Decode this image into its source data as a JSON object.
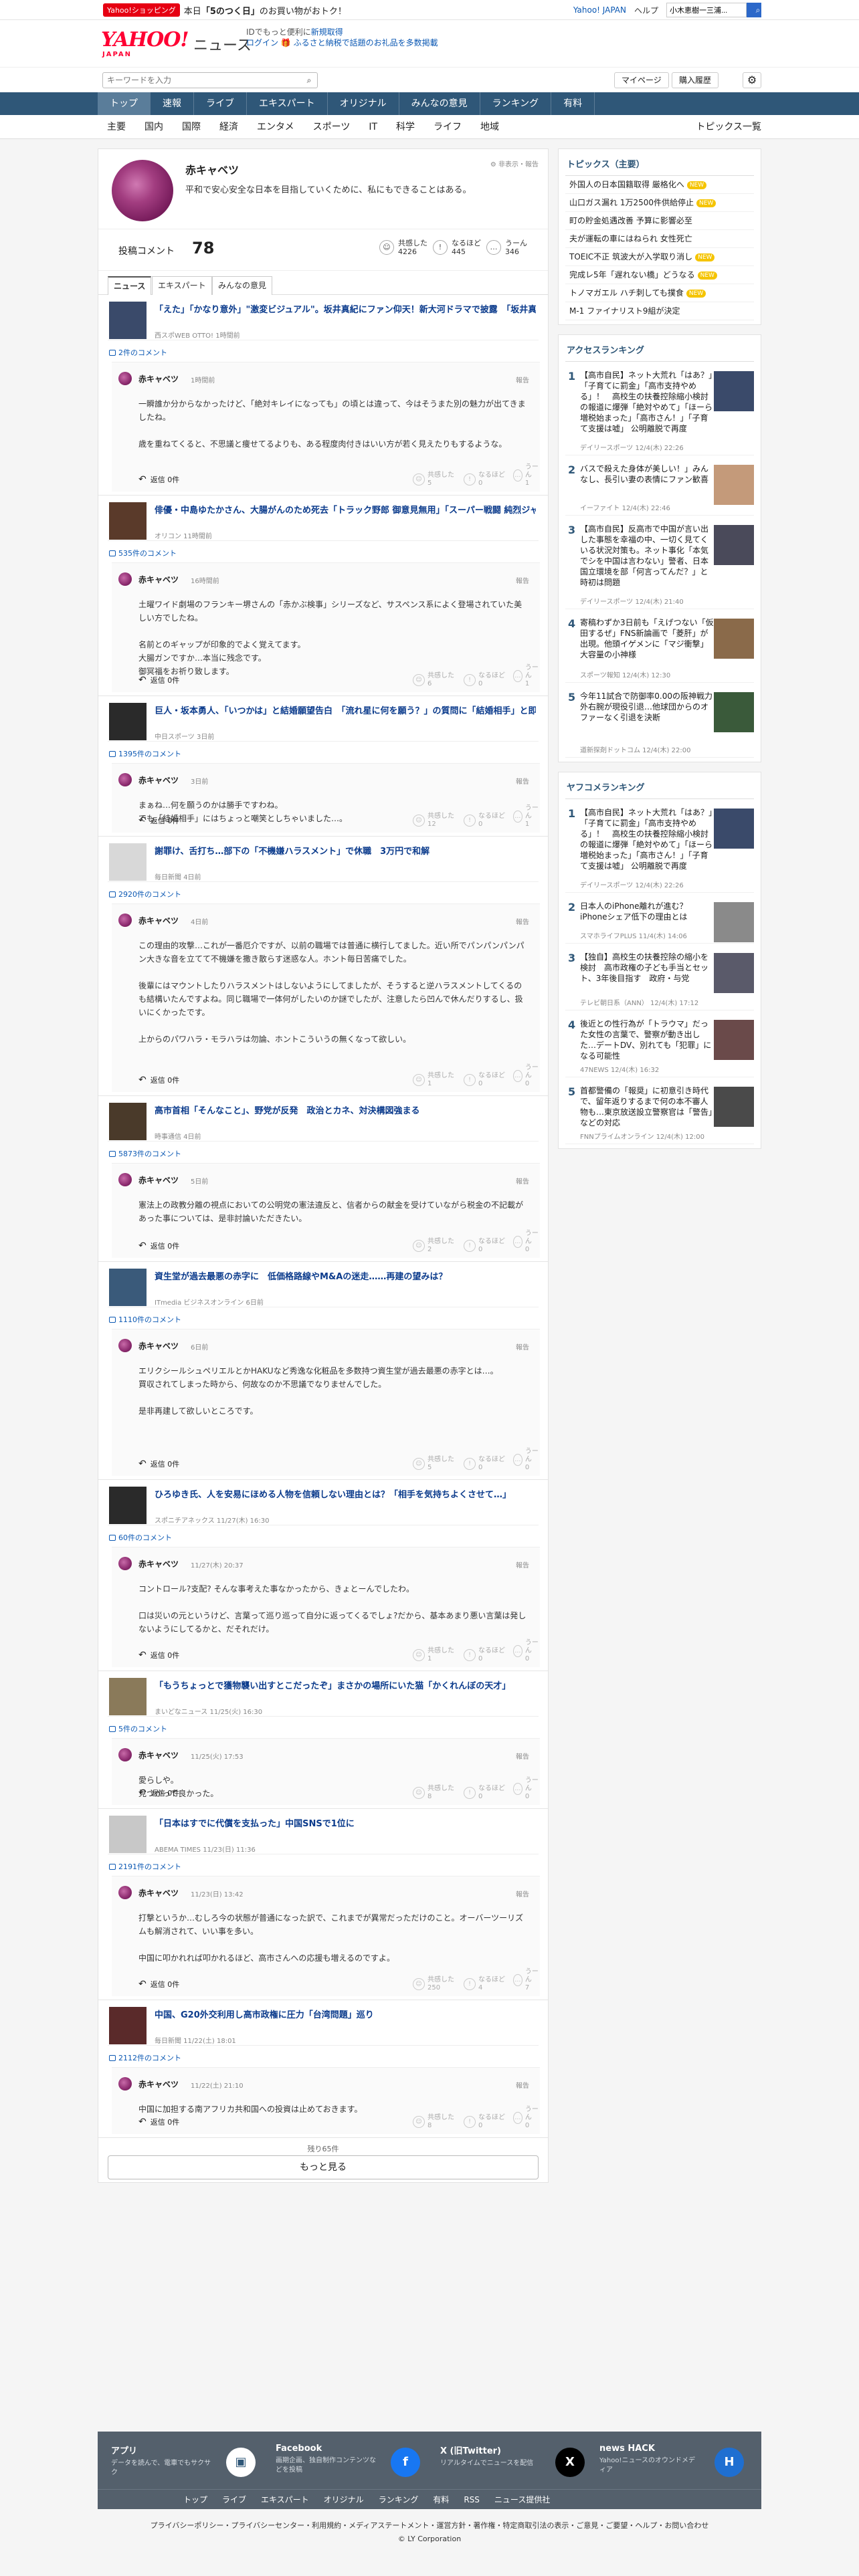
{
  "topbar": {
    "shop_badge": "Yahoo!ショッピング",
    "promo_text": "本日「5のつく日」のお買い物がお得だ！",
    "promo_pre": "本日",
    "promo_bold": "「5のつく日」",
    "promo_post": "のお買い物がおトク！",
    "yahoo_japan": "Yahoo! JAPAN",
    "help": "ヘルプ",
    "search_placeholder": "ウェブ検索",
    "search_value": "小木恵樹一三浦..."
  },
  "header": {
    "logo": "YAHOO!",
    "logo_sub": "JAPAN",
    "section": "ニュース",
    "login_line1_pre": "IDでもっと便利に",
    "login_line1_link": "新規取得",
    "login_link": "ログイン",
    "furusato": "ふるさと納税で話題のお礼品を多数掲載"
  },
  "search": {
    "placeholder": "キーワードを入力",
    "mypage": "マイページ",
    "purchase": "購入履歴"
  },
  "nav": [
    "トップ",
    "速報",
    "ライブ",
    "エキスパート",
    "オリジナル",
    "みんなの意見",
    "ランキング",
    "有料"
  ],
  "subnav": [
    "主要",
    "国内",
    "国際",
    "経済",
    "エンタメ",
    "スポーツ",
    "IT",
    "科学",
    "ライフ",
    "地域"
  ],
  "subnav_right": "トピックス一覧",
  "profile": {
    "name": "赤キャベツ",
    "bio": "平和で安心安全な日本を目指していくために、私にもできることはある。",
    "mode": "非表示・報告"
  },
  "stats": {
    "label": "投稿コメント",
    "count": "78",
    "reactions": [
      {
        "icon": "☺",
        "label": "共感した",
        "value": "4226"
      },
      {
        "icon": "!",
        "label": "なるほど",
        "value": "445"
      },
      {
        "icon": "…",
        "label": "うーん",
        "value": "346"
      }
    ]
  },
  "tabs": [
    "ニュース",
    "エキスパート",
    "みんなの意見"
  ],
  "feed": [
    {
      "title": "「えた」「かなり意外」\"激変ビジュアル\"。坂井真紀にファン仰天！新大河ドラマで披露　「坂井真紀さんをここまで汚すのは…」",
      "source": "西スポWEB OTTO! 1時間前",
      "ccount": "2件のコメント",
      "user": "赤キャベツ",
      "date": "1時間前",
      "report": "報告",
      "body": "一瞬誰か分からなかったけど、「絶対キレイになっても」の頃とは違って、今はそうまた別の魅力が出てきましたね。\n\n歳を重ねてくると、不思議と痩せてるよりも、ある程度肉付きはいい方が若く見えたりもするような。",
      "reply": "返信 0件",
      "r": [
        "5",
        "0",
        "1"
      ],
      "thumb": "#3a4a6a"
    },
    {
      "title": "俳優・中島ゆたかさん、大腸がんのため死去「トラック野郎 御意見無用」「スーパー戦闘 純烈ジャー」などに出演",
      "source": "オリコン 11時間前",
      "ccount": "535件のコメント",
      "user": "赤キャベツ",
      "date": "16時間前",
      "report": "報告",
      "body": "土曜ワイド劇場のフランキー堺さんの「赤かぶ検事」シリーズなど、サスペンス系によく登場されていた美しい方でしたね。\n\n名前とのギャップが印象的でよく覚えてます。\n大腸ガンですか…本当に残念です。\n御冥福をお祈り致します。",
      "reply": "返信 0件",
      "r": [
        "6",
        "0",
        "1"
      ],
      "thumb": "#5a3a2a"
    },
    {
      "title": "巨人・坂本勇人、「いつかは」と結婚願望告白　「流れ星に何を願う？」の質問に「結婚相手」と即答。女性ファンから歓声と悲鳴",
      "source": "中日スポーツ 3日前",
      "ccount": "1395件のコメント",
      "user": "赤キャベツ",
      "date": "3日前",
      "report": "報告",
      "body": "まぁね…何を願うのかは勝手ですわね。\nでも「結婚相手」にはちょっと嘲笑としちゃいました…。",
      "reply": "返信 0件",
      "r": [
        "12",
        "0",
        "1"
      ],
      "thumb": "#2a2a2a"
    },
    {
      "title": "謝罪け、舌打ち…部下の「不機嫌ハラスメント」で休職　3万円で和解",
      "source": "毎日新聞 4日前",
      "ccount": "2920件のコメント",
      "user": "赤キャベツ",
      "date": "4日前",
      "report": "報告",
      "body": "この理由的攻撃…これが一番厄介ですが、以前の職場では普通に横行してました。近い所でパンパンパンパン大きな音を立てて不機嫌を撒き散らす迷惑な人。ホント毎日苦痛でした。\n\n後輩にはマウントしたりハラスメントはしないようにしてましたが、そうすると逆ハラスメントしてくるのも結構いたんですよね。同じ職場で一体何がしたいのか謎でしたが、注意したら凹んで休んだりするし、扱いにくかったです。\n\n上からのパワハラ・モラハラは勿論、ホントこういうの無くなって欲しい。",
      "reply": "返信 0件",
      "r": [
        "1",
        "0",
        "0"
      ],
      "thumb": "#d8d8d8"
    },
    {
      "title": "高市首相「そんなこと」、野党が反発　政治とカネ、対決構図強まる",
      "source": "時事通信 4日前",
      "ccount": "5873件のコメント",
      "user": "赤キャベツ",
      "date": "5日前",
      "report": "報告",
      "body": "憲法上の政教分離の視点においての公明党の憲法違反と、信者からの献金を受けていながら税金の不記載があった事については、是非討論いただきたい。",
      "reply": "返信 0件",
      "r": [
        "2",
        "0",
        "0"
      ],
      "thumb": "#4a3a2a"
    },
    {
      "title": "資生堂が過去最悪の赤字に　低価格路線やM&Aの迷走……再建の望みは？",
      "source": "ITmedia ビジネスオンライン 6日前",
      "ccount": "1110件のコメント",
      "user": "赤キャベツ",
      "date": "6日前",
      "report": "報告",
      "body": "エリクシールシュペリエルとかHAKUなど秀逸な化粧品を多数持つ資生堂が過去最悪の赤字とは…。\n買収されてしまった時から、何故なのか不思議でなりませんでした。\n\n是非再建して欲しいところです。",
      "reply": "返信 0件",
      "r": [
        "5",
        "0",
        "0"
      ],
      "thumb": "#3a5a7a"
    },
    {
      "title": "ひろゆき氏、人を安易にほめる人物を信頼しない理由とは？「相手を気持ちよくさせて…」",
      "source": "スポニチアネックス 11/27(木) 16:30",
      "ccount": "60件のコメント",
      "user": "赤キャベツ",
      "date": "11/27(木) 20:37",
      "report": "報告",
      "body": "コントロール?支配? そんな事考えた事なかったから、きょとーんでしたわ。\n\n口は災いの元というけど、言葉って巡り巡って自分に返ってくるでしょ?だから、基本あまり悪い言葉は発しないようにしてるかと、だそれだけ。",
      "reply": "返信 0件",
      "r": [
        "1",
        "0",
        "0"
      ],
      "thumb": "#2a2a2a"
    },
    {
      "title": "「もうちょっとで獲物襲い出すとこだったぞ」まさかの場所にいた猫「かくれんぼの天才」",
      "source": "まいどなニュース 11/25(火) 16:30",
      "ccount": "5件のコメント",
      "user": "赤キャベツ",
      "date": "11/25(火) 17:53",
      "report": "報告",
      "body": "愛らしや。\n見つかって良かった。",
      "reply": "返信 0件",
      "r": [
        "8",
        "0",
        "0"
      ],
      "thumb": "#8a7a5a"
    },
    {
      "title": "「日本はすでに代償を支払った」中国SNSで1位に",
      "source": "ABEMA TIMES 11/23(日) 11:36",
      "ccount": "2191件のコメント",
      "user": "赤キャベツ",
      "date": "11/23(日) 13:42",
      "report": "報告",
      "body": "打撃というか…むしろ今の状態が普通になった訳で、これまでが異常だっただけのこと。オーバーツーリズムも解消されて、いい事を多い。\n\n中国に叩かれれば叩かれるほど、高市さんへの応援も増えるのですよ。",
      "reply": "返信 0件",
      "r": [
        "250",
        "4",
        "7"
      ],
      "thumb": "#c8c8c8"
    },
    {
      "title": "中国、G20外交利用し高市政権に圧力「台湾問題」巡り",
      "source": "毎日新聞 11/22(土) 18:01",
      "ccount": "2112件のコメント",
      "user": "赤キャベツ",
      "date": "11/22(土) 21:10",
      "report": "報告",
      "body": "中国に加担する南アフリカ共和国への投資は止めておきます。",
      "reply": "返信 0件",
      "r": [
        "8",
        "0",
        "0"
      ],
      "thumb": "#5a2a2a"
    }
  ],
  "reaction_labels": [
    "共感した",
    "なるほど",
    "うーん"
  ],
  "more": {
    "remaining": "残り65件",
    "button": "もっと見る"
  },
  "sidebar": {
    "topics_title": "トピックス（主要）",
    "topics": [
      {
        "t": "外国人の日本国籍取得 厳格化へ",
        "new": true
      },
      {
        "t": "山口ガス漏れ 1万2500件供給停止",
        "new": true
      },
      {
        "t": "町の貯金処遇改善 予算に影響必至",
        "new": false
      },
      {
        "t": "夫が運転の車にはねられ 女性死亡",
        "new": false
      },
      {
        "t": "TOEIC不正 筑波大が入学取り消し",
        "new": true
      },
      {
        "t": "完成レ5年「遅れない橋」どうなる",
        "new": true
      },
      {
        "t": "トノマガエル ハチ刺しても撲食",
        "new": true
      },
      {
        "t": "M-1 ファイナリスト9組が決定",
        "new": false
      }
    ],
    "access_title": "アクセスランキング",
    "access": [
      {
        "n": "1",
        "t": "【高市自民】ネット大荒れ「はあ？」「子育てに罰金」「高市支持やめる」！　高校生の扶養控除縮小検討の報道に爆弾「絶対やめて」「ほーら増税始まった」「高市さん！」「子育て支援は嘘」 公明離脱で再度",
        "s": "デイリースポーツ 12/4(木) 22:26",
        "img": "#3a4a6a"
      },
      {
        "n": "2",
        "t": "バスで殺えた身体が美しい！」みんなし、長引い妻の表情にファン歓喜",
        "s": "イーファイト 12/4(木) 22:46",
        "img": "#c49a7a"
      },
      {
        "n": "3",
        "t": "【高市自民】反高市で中国が言い出した事態を幸福の中、一切く見てくいる状況対策も。ネット事化「本気でシを中国は言わない」警者、日本国立環境を部「何言ってんだ？」と時初は問題",
        "s": "デイリースポーツ 12/4(木) 21:40",
        "img": "#4a4a5a"
      },
      {
        "n": "4",
        "t": "寄稿わずか3日前も「えげつない「仮田するぜ」FNS新論画で「菱肝」が出現。他頭イゲメンに「マジ衝撃」大容量の小神様",
        "s": "スポーツ報知 12/4(木) 12:30",
        "img": "#8a6a4a"
      },
      {
        "n": "5",
        "t": "今年11試合で防御率0.00の阪神戦力外右腕が現役引退…他球団からのオファーなく引退を決断",
        "s": "道新探剤ドットコム 12/4(木) 22:00",
        "img": "#3a5a3a"
      }
    ],
    "yafoo_title": "ヤフコメランキング",
    "yafoo": [
      {
        "n": "1",
        "t": "【高市自民】ネット大荒れ「はあ？」「子育てに罰金」「高市支持やめる」！　高校生の扶養控除縮小検討の報道に爆弾「絶対やめて」「ほーら増税始まった」「高市さん！」「子育て支援は嘘」 公明離脱で再度",
        "s": "デイリースポーツ 12/4(木) 22:26",
        "img": "#3a4a6a"
      },
      {
        "n": "2",
        "t": "日本人のiPhone離れが進む？ iPhoneシェア低下の理由とは",
        "s": "スマホライフPLUS 11/4(木) 14:06",
        "img": "#8a8a8a"
      },
      {
        "n": "3",
        "t": "【独自】高校生の扶養控除の縮小を検討　高市政権の子ども手当とセット、3年後目指す　政府・与党",
        "s": "テレビ朝日系（ANN） 12/4(木) 17:12",
        "img": "#5a5a6a"
      },
      {
        "n": "4",
        "t": "後近との性行為が「トラウマ」だった女性の言葉で、警察が動き出した…デートDV、別れても「犯罪」になる可能性",
        "s": "47NEWS 12/4(木) 16:32",
        "img": "#6a4a4a"
      },
      {
        "n": "5",
        "t": "首都警備の「報奨」に初意引き時代で、留年返りするまで何の本不審人物も…東京放送設立警察官は「警告」などの対応",
        "s": "FNNプライムオンライン 12/4(木) 12:00",
        "img": "#4a4a4a"
      }
    ]
  },
  "footer": {
    "items": [
      {
        "h": "アプリ",
        "d": "データを読んで、電車でもサクサク",
        "logo": "▣"
      },
      {
        "h": "Facebook",
        "d": "画期企画、独自制作コンテンツなどを投稿",
        "logo": "f"
      },
      {
        "h": "X (旧Twitter)",
        "d": "リアルタイムでニュースを配信",
        "logo": "X"
      },
      {
        "h": "news HACK",
        "d": "Yahoo!ニュースのオウンドメディア",
        "logo": "H"
      }
    ],
    "nav": [
      "トップ",
      "ライブ",
      "エキスパート",
      "オリジナル",
      "ランキング",
      "有料",
      "RSS",
      "ニュース提供社"
    ],
    "legal": "プライバシーポリシー・プライバシーセンター・利用規約・メディアステートメント・運営方針・著作権・特定商取引法の表示・ご意見・ご要望・ヘルプ・お問い合わせ",
    "copy": "© LY Corporation"
  }
}
